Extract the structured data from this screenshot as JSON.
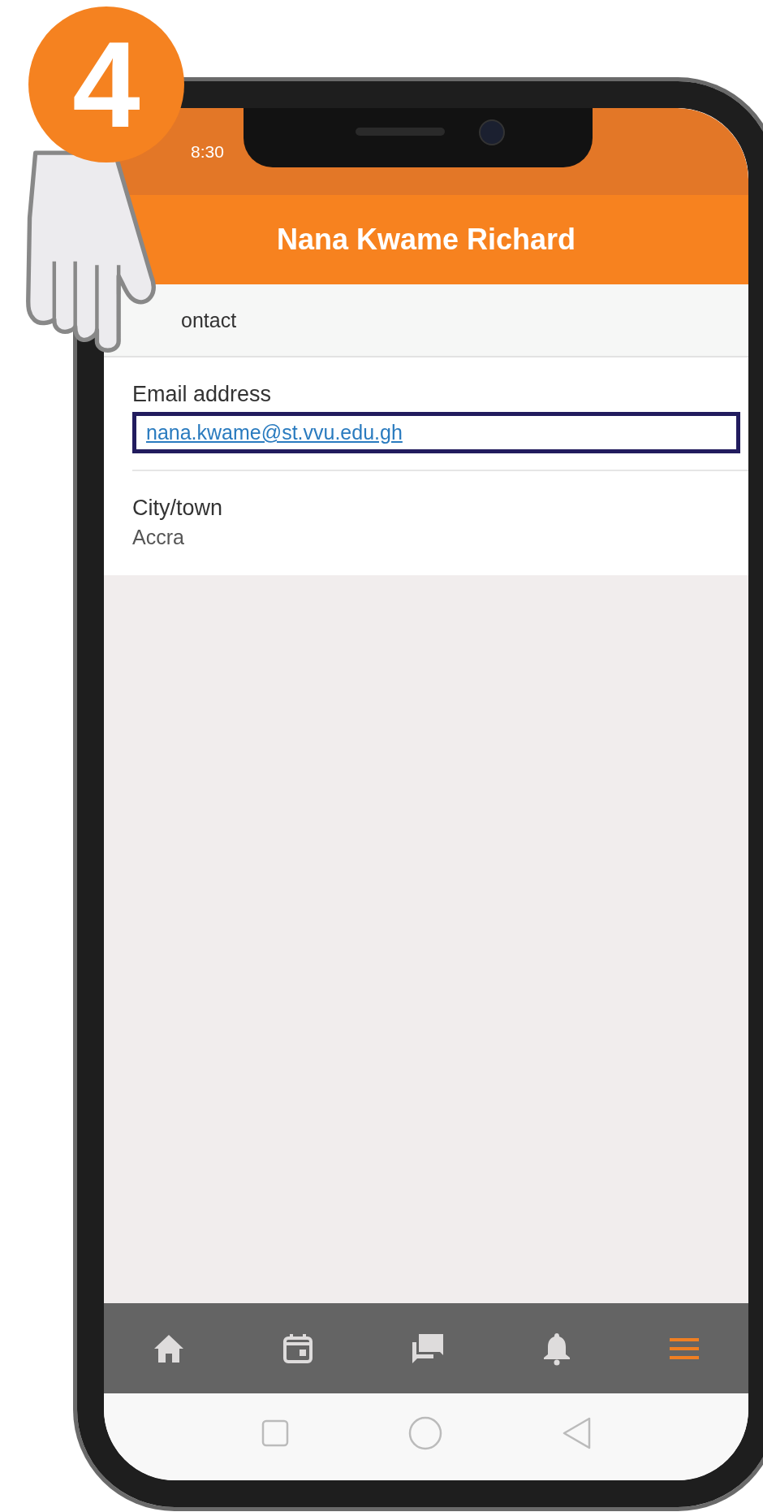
{
  "step_badge": "4",
  "status_bar": {
    "time": "8:30"
  },
  "header": {
    "title": "Nana Kwame Richard"
  },
  "section": {
    "title": "ontact"
  },
  "fields": [
    {
      "kind": "link",
      "label": "Email address",
      "value": "nana.kwame@st.vvu.edu.gh",
      "highlighted": true
    },
    {
      "kind": "text",
      "label": "City/town",
      "value": "Accra",
      "highlighted": false
    }
  ],
  "bottom_nav": [
    {
      "kind": "home",
      "selected": false
    },
    {
      "kind": "calendar",
      "selected": false
    },
    {
      "kind": "chat",
      "selected": false
    },
    {
      "kind": "bell",
      "selected": false
    },
    {
      "kind": "menu",
      "selected": true
    }
  ]
}
